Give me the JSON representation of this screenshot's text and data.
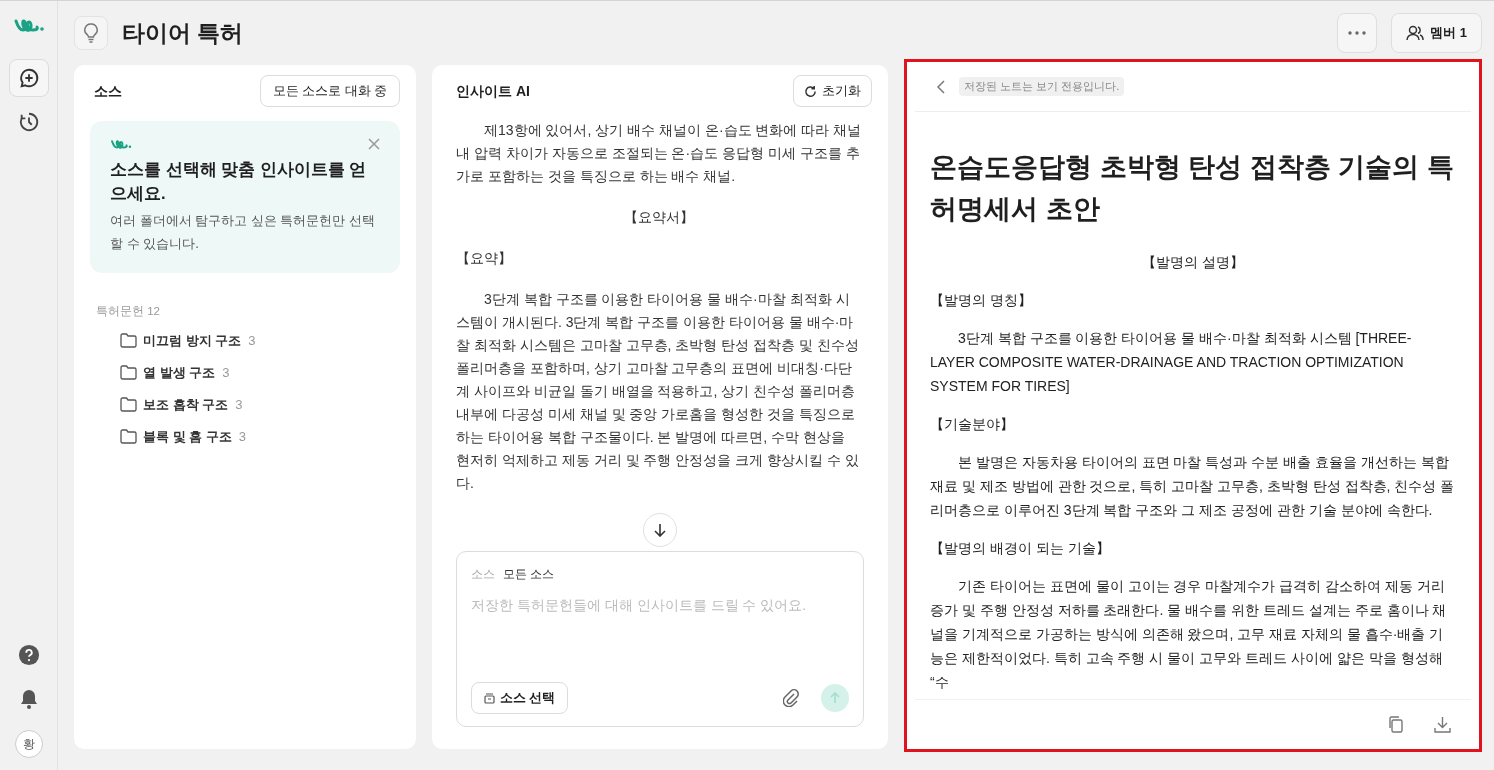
{
  "header": {
    "title": "타이어 특허",
    "member_button": "멤버 1"
  },
  "rail": {
    "avatar": "황"
  },
  "sources": {
    "title": "소스",
    "scope_button": "모든 소스로 대화 중",
    "tip": {
      "title": "소스를 선택해 맞춤 인사이트를 얻으세요.",
      "body": "여러 폴더에서 탐구하고 싶은 특허문헌만 선택할 수 있습니다."
    },
    "group_label": "특허문헌 12",
    "folders": [
      {
        "name": "미끄럼 방지 구조",
        "count": "3"
      },
      {
        "name": "열 발생 구조",
        "count": "3"
      },
      {
        "name": "보조 흡착 구조",
        "count": "3"
      },
      {
        "name": "블록 및 홈 구조",
        "count": "3"
      }
    ]
  },
  "chat": {
    "title": "인사이트 AI",
    "reset_button": "초기화",
    "blocks": [
      {
        "kind": "indented",
        "text": "제13항에 있어서, 상기 배수 채널이 온·습도 변화에 따라 채널 내 압력 차이가 자동으로 조절되는 온·습도 응답형 미세 구조를 추가로 포함하는 것을 특징으로 하는 배수 채널."
      },
      {
        "kind": "center",
        "text": "【요약서】"
      },
      {
        "kind": "heading",
        "text": "【요약】"
      },
      {
        "kind": "indented",
        "text": "3단계 복합 구조를 이용한 타이어용 물 배수·마찰 최적화 시스템이 개시된다. 3단계 복합 구조를 이용한 타이어용 물 배수·마찰 최적화 시스템은 고마찰 고무층, 초박형 탄성 접착층 및 친수성 폴리머층을 포함하며, 상기 고마찰 고무층의 표면에 비대칭·다단계 사이프와 비균일 돌기 배열을 적용하고, 상기 친수성 폴리머층 내부에 다공성 미세 채널 및 중앙 가로홈을 형성한 것을 특징으로 하는 타이어용 복합 구조물이다. 본 발명에 따르면, 수막 현상을 현저히 억제하고 제동 거리 및 주행 안정성을 크게 향상시킬 수 있다."
      }
    ],
    "composer": {
      "source_label": "소스",
      "source_value": "모든 소스",
      "placeholder": "저장한 특허문헌들에 대해 인사이트를 드릴 수 있어요.",
      "select_button": "소스 선택"
    }
  },
  "note": {
    "notice": "저장된 노트는 보기 전용입니다.",
    "title": "온습도응답형 초박형 탄성 접착층 기술의 특허명세서 초안",
    "blocks": [
      {
        "kind": "center",
        "text": "【발명의 설명】"
      },
      {
        "kind": "heading",
        "text": "【발명의 명칭】"
      },
      {
        "kind": "indented",
        "text": "3단계 복합 구조를 이용한 타이어용 물 배수·마찰 최적화 시스템 [THREE-LAYER COMPOSITE WATER-DRAINAGE AND TRACTION OPTIMIZATION SYSTEM FOR TIRES]"
      },
      {
        "kind": "heading",
        "text": "【기술분야】"
      },
      {
        "kind": "indented",
        "text": "본 발명은 자동차용 타이어의 표면 마찰 특성과 수분 배출 효율을 개선하는 복합 재료 및 제조 방법에 관한 것으로, 특히 고마찰 고무층, 초박형 탄성 접착층, 친수성 폴리머층으로 이루어진 3단계 복합 구조와 그 제조 공정에 관한 기술 분야에 속한다."
      },
      {
        "kind": "heading",
        "text": "【발명의 배경이 되는 기술】"
      },
      {
        "kind": "indented",
        "text": "기존 타이어는 표면에 물이 고이는 경우 마찰계수가 급격히 감소하여 제동 거리 증가 및 주행 안정성 저하를 초래한다. 물 배수를 위한 트레드 설계는 주로 홈이나 채널을 기계적으로 가공하는 방식에 의존해 왔으며, 고무 재료 자체의 물 흡수·배출 기능은 제한적이었다. 특히 고속 주행 시 물이 고무와 트레드 사이에 얇은 막을 형성해 “수"
      }
    ]
  }
}
